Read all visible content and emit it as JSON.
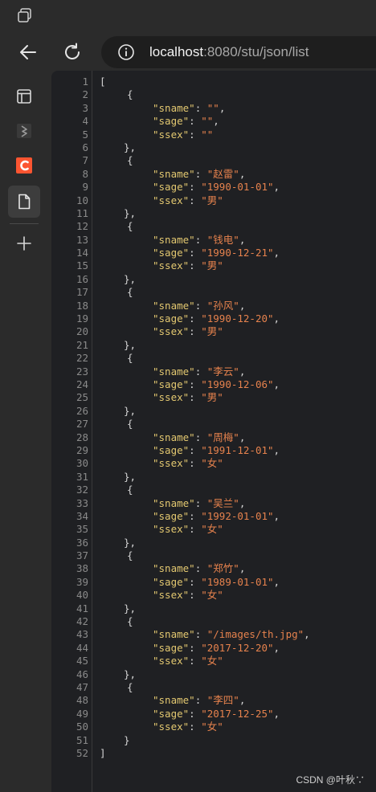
{
  "browser": {
    "url_host": "localhost",
    "url_rest": ":8080/stu/json/list"
  },
  "sidebar": {
    "items": [
      {
        "name": "workspaces"
      },
      {
        "name": "extension"
      },
      {
        "name": "csdn"
      },
      {
        "name": "page"
      }
    ]
  },
  "json_viewer": {
    "open_bracket": "[",
    "close_bracket": "]",
    "keys": [
      "sname",
      "sage",
      "ssex"
    ],
    "records": [
      {
        "sname": "",
        "sage": "",
        "ssex": ""
      },
      {
        "sname": "赵雷",
        "sage": "1990-01-01",
        "ssex": "男"
      },
      {
        "sname": "钱电",
        "sage": "1990-12-21",
        "ssex": "男"
      },
      {
        "sname": "孙风",
        "sage": "1990-12-20",
        "ssex": "男"
      },
      {
        "sname": "李云",
        "sage": "1990-12-06",
        "ssex": "男"
      },
      {
        "sname": "周梅",
        "sage": "1991-12-01",
        "ssex": "女"
      },
      {
        "sname": "吴兰",
        "sage": "1992-01-01",
        "ssex": "女"
      },
      {
        "sname": "郑竹",
        "sage": "1989-01-01",
        "ssex": "女"
      },
      {
        "sname": "/images/th.jpg",
        "sage": "2017-12-20",
        "ssex": "女"
      },
      {
        "sname": "李四",
        "sage": "2017-12-25",
        "ssex": "女"
      }
    ]
  },
  "watermark": "CSDN @叶秋∵",
  "colors": {
    "key": "#e2c770",
    "string": "#e6824d",
    "csdn_brand": "#fc5531"
  }
}
